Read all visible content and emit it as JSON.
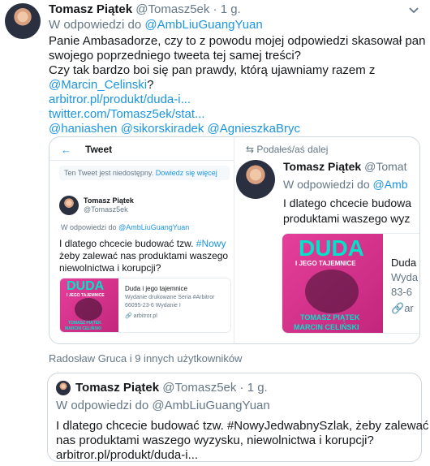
{
  "tweet": {
    "author_name": "Tomasz Piątek",
    "author_handle": "@Tomasz5ek",
    "time": "· 1 g.",
    "reply_prefix": "W odpowiedzi do",
    "reply_to": "@AmbLiuGuangYuan",
    "lines": [
      "Panie Ambasadorze, czy to z powodu mojej odpowiedzi skasował pan",
      "swojego poprzedniego tweeta tej samej treści?",
      "Czy tak bardzo boi się pan prawdy, którą ujawniamy razem z"
    ],
    "mention_line": "@Marcin_Celinski",
    "mention_tail": "?",
    "link1": "arbitror.pl/produkt/duda-i...",
    "link2": "twitter.com/Tomasz5ek/stat...",
    "mentions": "@haniashen @sikorskiradek @AgnieszkaBryc"
  },
  "image_left": {
    "header_title": "Tweet",
    "unavailable": "Ten Tweet jest niedostępny.",
    "learn_more": "Dowiedz się więcej",
    "author_name": "Tomasz Piątek",
    "author_handle": "@Tomasz5ek",
    "reply_prefix": "W odpowiedzi do",
    "reply_to": "@AmbLiuGuangYuan",
    "text_line1": "I dlatego chcecie budować tzw.",
    "text_hashtag": "#Nowy",
    "text_line2": "żeby zalewać nas produktami waszego",
    "text_line3": "niewolnictwa i korupcji?",
    "card_title": "Duda i jego tajemnice",
    "card_desc1": "Wydanie drukowane Seria #Arbitror",
    "card_desc2": "66095-23-6 Wydanie I",
    "card_link": "arbitror.pl",
    "book_title": "DUDA",
    "book_sub": "I JEGO TAJEMNICE",
    "book_author1": "TOMASZ PIĄTEK",
    "book_author2": "MARCIN CELIŃSKI"
  },
  "image_right": {
    "retweet_label": "Podałeś/aś dalej",
    "author_name": "Tomasz Piątek",
    "author_handle": "@Tomat",
    "reply_prefix": "W odpowiedzi do",
    "reply_to": "@Amb",
    "text_line1": "I dlatego chcecie budowa",
    "text_line2": "produktami waszego wyz",
    "card_title": "Duda",
    "card_desc1": "Wyda",
    "card_desc2": "83-6",
    "card_link": "ar",
    "book_title": "DUDA",
    "book_sub": "I JEGO TAJEMNICE",
    "book_author1": "TOMASZ PIĄTEK",
    "book_author2": "MARCIN CELIŃSKI"
  },
  "likes_footer": "Radosław Gruca i 9 innych użytkowników",
  "quote": {
    "author_name": "Tomasz Piątek",
    "author_handle": "@Tomasz5ek",
    "time": "· 1 g.",
    "reply_prefix": "W odpowiedzi do",
    "reply_to": "@AmbLiuGuangYuan",
    "line1": "I dlatego chcecie budować tzw. #NowyJedwabnySzlak, żeby zalewać",
    "line2": "nas produktami waszego wyzysku, niewolnictwa i korupcji?",
    "line3": "arbitror.pl/produkt/duda-i..."
  },
  "colors": {
    "link": "#1b95e0",
    "muted": "#657786",
    "book_pink": "#e53f9b",
    "book_title": "#00e3c8"
  },
  "icons": [
    "chevron-down-icon",
    "back-arrow-icon",
    "retweet-icon",
    "link-icon"
  ]
}
